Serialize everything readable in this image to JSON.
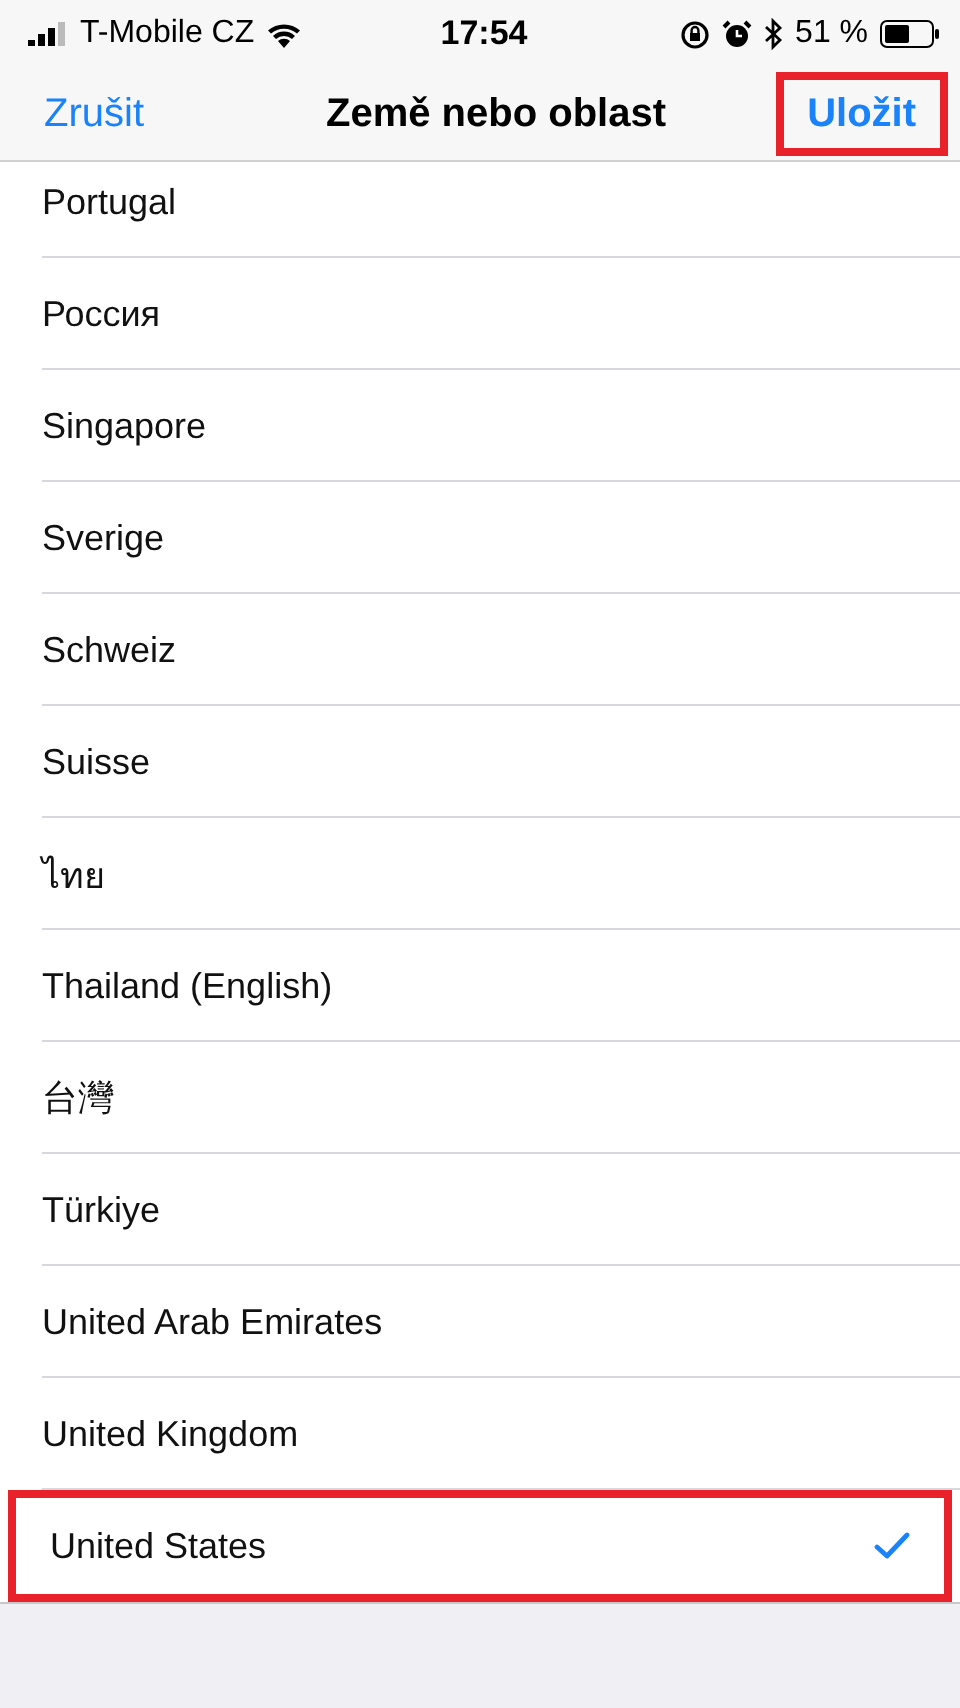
{
  "status_bar": {
    "carrier": "T-Mobile CZ",
    "time": "17:54",
    "battery": "51 %"
  },
  "nav": {
    "cancel": "Zrušit",
    "title": "Země nebo oblast",
    "save": {
      "label": "Uložit",
      "highlighted": true
    }
  },
  "countries": [
    {
      "name": "Portugal",
      "selected": false,
      "highlighted": false
    },
    {
      "name": "Россия",
      "selected": false,
      "highlighted": false
    },
    {
      "name": "Singapore",
      "selected": false,
      "highlighted": false
    },
    {
      "name": "Sverige",
      "selected": false,
      "highlighted": false
    },
    {
      "name": "Schweiz",
      "selected": false,
      "highlighted": false
    },
    {
      "name": "Suisse",
      "selected": false,
      "highlighted": false
    },
    {
      "name": "ไทย",
      "selected": false,
      "highlighted": false
    },
    {
      "name": "Thailand (English)",
      "selected": false,
      "highlighted": false
    },
    {
      "name": "台灣",
      "selected": false,
      "highlighted": false
    },
    {
      "name": "Türkiye",
      "selected": false,
      "highlighted": false
    },
    {
      "name": "United Arab Emirates",
      "selected": false,
      "highlighted": false
    },
    {
      "name": "United Kingdom",
      "selected": false,
      "highlighted": false
    },
    {
      "name": "United States",
      "selected": true,
      "highlighted": true
    }
  ]
}
